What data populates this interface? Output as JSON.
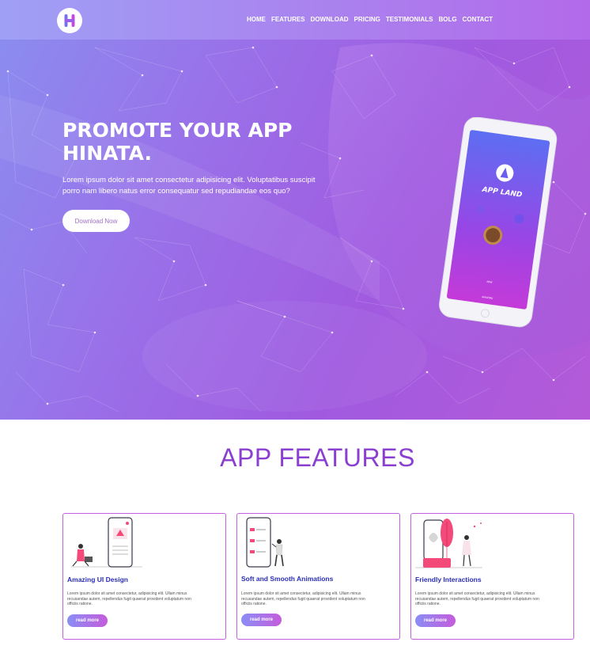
{
  "nav": {
    "links": [
      "HOME",
      "FEATURES",
      "DOWNLOAD",
      "PRICING",
      "TESTIMONIALS",
      "BOLG",
      "CONTACT"
    ]
  },
  "hero": {
    "title": "PROMOTE YOUR APP HINATA.",
    "text": "Lorem ipsum dolor sit amet consectetur adipisicing elit. Voluptatibus suscipit porro nam libero natus error consequatur sed repudiandae eos quo?",
    "download_label": "Download Now",
    "phone_app_name": "APP LAND",
    "phone_small_1": "NEW",
    "phone_small_2": "AMAZING"
  },
  "features": {
    "title": "APP FEATURES",
    "cards": [
      {
        "title": "Amazing UI Design",
        "text": "Lorem ipsum dolor sit amet consectetur, adipisicing elit. Ullam minus recusandae autem, repellendus fugit quaerat provident voluptatum non officiis ratione.",
        "button": "read more"
      },
      {
        "title": "Soft and Smooth Animations",
        "text": "Lorem ipsum dolor sit amet consectetur, adipisicing elit. Ullam minus recusandae autem, repellendus fugit quaerat provident voluptatum non officiis ratione.",
        "button": "read more"
      },
      {
        "title": "Friendly Interactions",
        "text": "Lorem ipsum dolor sit amet consectetur, adipisicing elit. Ullam minus recusandae autem, repellendus fugit quaerat provident voluptatum non officiis ratione.",
        "button": "read more"
      }
    ]
  },
  "colors": {
    "accent": "#8a3fd1",
    "card_border": "#c45fe0",
    "card_title": "#2a2fb6",
    "button_start": "#8a8ef5",
    "button_end": "#c55cdc"
  },
  "icons": [
    "logo-h-icon"
  ]
}
